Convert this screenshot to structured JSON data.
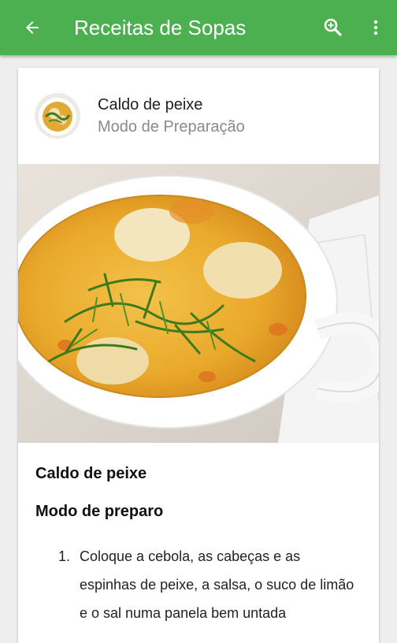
{
  "app_bar": {
    "title": "Receitas de Sopas",
    "back_icon": "arrow-left-icon",
    "search_icon": "zoom-search-icon",
    "more_icon": "more-vert-icon",
    "color": "#4caf50"
  },
  "card": {
    "title": "Caldo de peixe",
    "subtitle": "Modo de Preparação",
    "hero_image": "fish-soup-bowl-photo"
  },
  "content": {
    "recipe_title": "Caldo de peixe",
    "section_title": "Modo de preparo",
    "steps": [
      {
        "number": "1.",
        "text": "Coloque a cebola, as cabeças e as espinhas de peixe, a salsa, o suco de limão e o sal numa panela bem untada"
      }
    ]
  }
}
